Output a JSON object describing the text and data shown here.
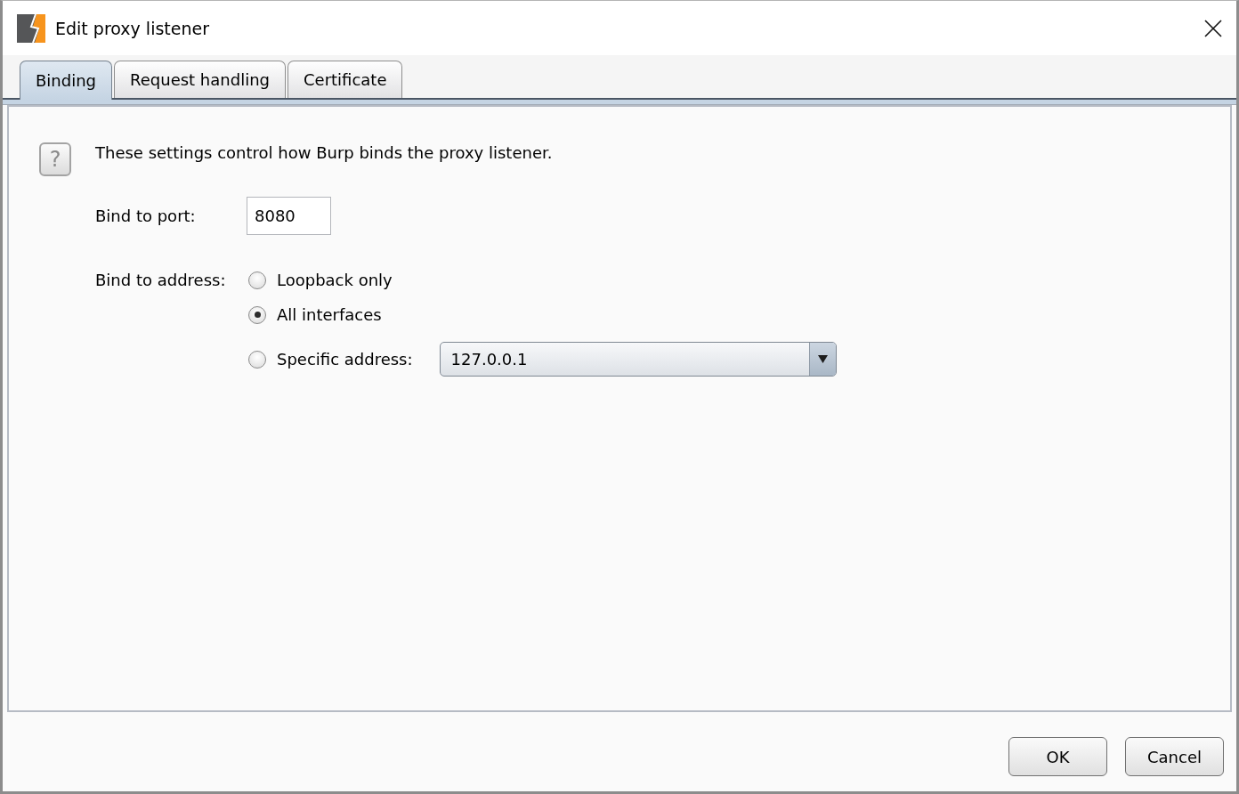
{
  "window": {
    "title": "Edit proxy listener"
  },
  "tabs": [
    {
      "label": "Binding",
      "selected": true
    },
    {
      "label": "Request handling",
      "selected": false
    },
    {
      "label": "Certificate",
      "selected": false
    }
  ],
  "binding": {
    "help_glyph": "?",
    "description": "These settings control how Burp binds the proxy listener.",
    "port": {
      "label": "Bind to port:",
      "value": "8080"
    },
    "address": {
      "label": "Bind to address:",
      "options": [
        {
          "kind": "plain",
          "label": "Loopback only",
          "selected": false
        },
        {
          "kind": "plain",
          "label": "All interfaces",
          "selected": true
        },
        {
          "kind": "dropdown",
          "label": "Specific address:",
          "selected": false,
          "value": "127.0.0.1"
        }
      ]
    }
  },
  "buttons": [
    {
      "label": "OK"
    },
    {
      "label": "Cancel"
    }
  ]
}
